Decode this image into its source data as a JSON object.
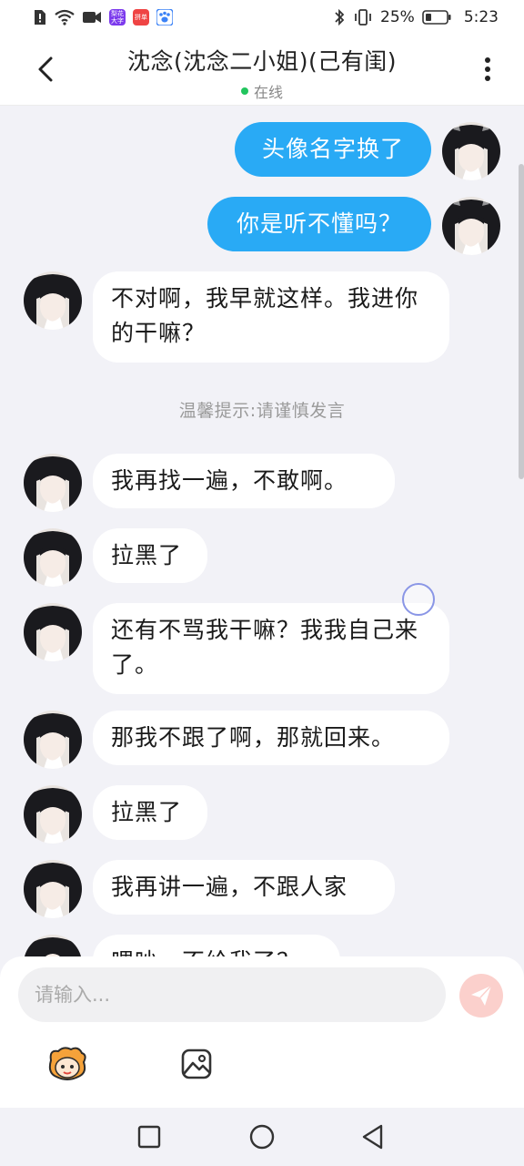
{
  "status_bar": {
    "battery_percent": "25%",
    "time": "5:23",
    "app_badges": [
      {
        "name": "news-app",
        "label": "梨花大字",
        "color": "#8b5cf6"
      },
      {
        "name": "shop-app",
        "label": "拼单",
        "color": "#ef4444"
      }
    ]
  },
  "header": {
    "back_icon": "chevron-left-icon",
    "title": "沈念(沈念二小姐)(己有闺)",
    "online_status": "在线",
    "online_color": "#22c55e",
    "more_icon": "vertical-dots-icon"
  },
  "messages": [
    {
      "side": "out",
      "text": "头像名字换了"
    },
    {
      "side": "out",
      "text": "你是听不懂吗？"
    },
    {
      "side": "in",
      "text": "不对啊，我早就这样。我进你的干嘛？"
    },
    {
      "type": "notice",
      "text": "温馨提示:请谨慎发言"
    },
    {
      "side": "in",
      "text": "我再找一遍，不敢啊。"
    },
    {
      "side": "in",
      "text": "拉黑了"
    },
    {
      "side": "in",
      "text": "还有不骂我干嘛？我我自己来了。"
    },
    {
      "side": "in",
      "text": "那我不跟了啊，那就回来。"
    },
    {
      "side": "in",
      "text": "拉黑了"
    },
    {
      "side": "in",
      "text": "我再讲一遍，不跟人家"
    },
    {
      "side": "in",
      "text": "喂吵，不给我了？"
    }
  ],
  "composer": {
    "placeholder": "请输入...",
    "send_icon": "paper-plane-icon",
    "emoji_icon": "cartoon-face-icon",
    "image_icon": "image-icon",
    "accent": "#29aaf5"
  },
  "navbar": {
    "recents_icon": "square-icon",
    "home_icon": "circle-icon",
    "back_icon": "triangle-back-icon"
  }
}
